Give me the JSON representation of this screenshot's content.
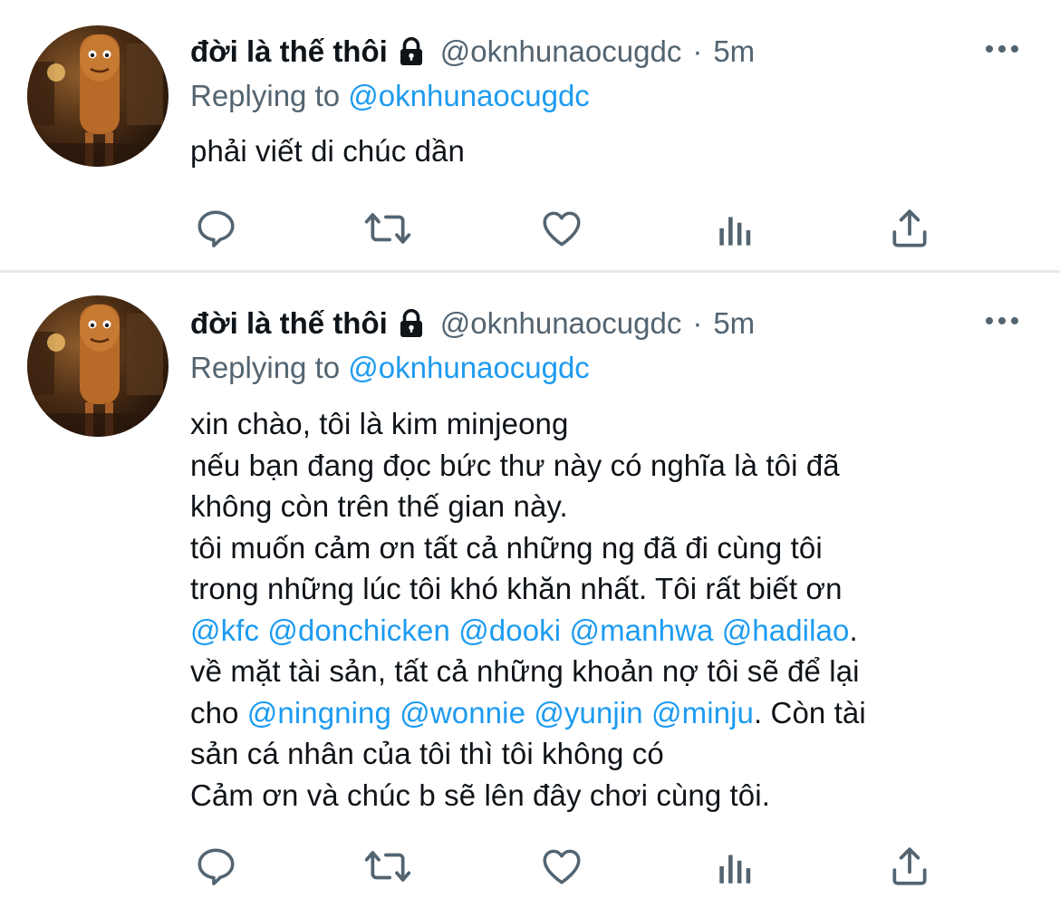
{
  "tweets": [
    {
      "display_name": "đời là thế thôi",
      "handle": "@oknhunaocugdc",
      "separator": "·",
      "time": "5m",
      "replying_prefix": "Replying to",
      "replying_to": "@oknhunaocugdc",
      "body_lines": [
        [
          {
            "t": "phải viết di chúc dần",
            "m": false
          }
        ]
      ]
    },
    {
      "display_name": "đời là thế thôi",
      "handle": "@oknhunaocugdc",
      "separator": "·",
      "time": "5m",
      "replying_prefix": "Replying to",
      "replying_to": "@oknhunaocugdc",
      "body_lines": [
        [
          {
            "t": "xin chào, tôi là kim minjeong",
            "m": false
          }
        ],
        [
          {
            "t": "nếu bạn đang đọc bức thư này có nghĩa là tôi đã",
            "m": false
          }
        ],
        [
          {
            "t": "không còn trên thế gian này.",
            "m": false
          }
        ],
        [
          {
            "t": "tôi muốn cảm ơn tất cả những ng đã đi cùng tôi",
            "m": false
          }
        ],
        [
          {
            "t": "trong những lúc tôi khó khăn nhất. Tôi rất biết ơn",
            "m": false
          }
        ],
        [
          {
            "t": "@kfc",
            "m": true
          },
          {
            "t": " ",
            "m": false
          },
          {
            "t": "@donchicken",
            "m": true
          },
          {
            "t": " ",
            "m": false
          },
          {
            "t": "@dooki",
            "m": true
          },
          {
            "t": " ",
            "m": false
          },
          {
            "t": "@manhwa",
            "m": true
          },
          {
            "t": " ",
            "m": false
          },
          {
            "t": "@hadilao",
            "m": true
          },
          {
            "t": ".",
            "m": false
          }
        ],
        [
          {
            "t": "về mặt tài sản, tất cả những khoản nợ tôi sẽ để lại",
            "m": false
          }
        ],
        [
          {
            "t": "cho ",
            "m": false
          },
          {
            "t": "@ningning",
            "m": true
          },
          {
            "t": " ",
            "m": false
          },
          {
            "t": "@wonnie",
            "m": true
          },
          {
            "t": " ",
            "m": false
          },
          {
            "t": "@yunjin",
            "m": true
          },
          {
            "t": " ",
            "m": false
          },
          {
            "t": "@minju",
            "m": true
          },
          {
            "t": ". Còn tài",
            "m": false
          }
        ],
        [
          {
            "t": "sản cá nhân của tôi thì tôi không có",
            "m": false
          }
        ],
        [
          {
            "t": "Cảm ơn và chúc b sẽ lên đây chơi cùng tôi.",
            "m": false
          }
        ]
      ]
    }
  ],
  "icons": {
    "more": "more-horizontal-icon",
    "lock": "lock-icon",
    "reply": "reply-icon",
    "retweet": "retweet-icon",
    "like": "like-heart-icon",
    "analytics": "analytics-icon",
    "share": "share-icon"
  },
  "colors": {
    "text": "#0f1419",
    "secondary": "#536471",
    "mention": "#1d9bf0",
    "divider": "#e7e9ea"
  }
}
